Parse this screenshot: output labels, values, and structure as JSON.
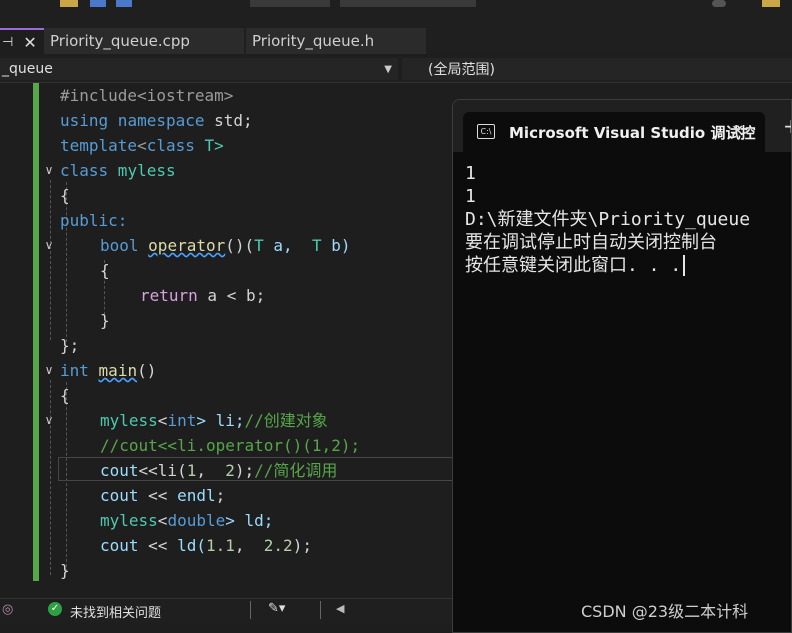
{
  "tabs": [
    {
      "label": "Priority_queue.cpp",
      "active": true
    },
    {
      "label": "Priority_queue.h",
      "active": false
    }
  ],
  "nav": {
    "scope_left": "_queue",
    "scope_right": "(全局范围)"
  },
  "code": {
    "l1": "#include<iostream>",
    "l2_a": "using",
    "l2_b": " namespace",
    "l2_c": " std;",
    "l3_a": "template",
    "l3_b": "<",
    "l3_c": "class",
    "l3_d": " T>",
    "l4_a": "class",
    "l4_b": " myless",
    "l5": "{",
    "l6": "public:",
    "l7_a": "bool",
    "l7_b": "operator",
    "l7_c": "()(",
    "l7_d": "T",
    "l7_e": " a,  ",
    "l7_f": "T",
    "l7_g": " b)",
    "l8": "{",
    "l9_a": "return",
    "l9_b": " a < b;",
    "l10": "}",
    "l11": "};",
    "l12_a": "int",
    "l12_b": "main",
    "l12_c": "()",
    "l13": "{",
    "l14_a": "myless",
    "l14_b": "<",
    "l14_c": "int",
    "l14_d": "> li;",
    "l14_e": "//创建对象",
    "l15": "//cout<<li.operator()(1,2);",
    "l16_a": "cout",
    "l16_b": "<<li(",
    "l16_c": "1",
    "l16_d": ",  ",
    "l16_e": "2",
    "l16_f": ");",
    "l16_g": "//简化调用",
    "l17_a": "cout",
    "l17_b": " << ",
    "l17_c": "endl",
    "l17_d": ";",
    "l18_a": "myless",
    "l18_b": "<",
    "l18_c": "double",
    "l18_d": "> ld;",
    "l19_a": "cout",
    "l19_b": " << ",
    "l19_c": "ld(",
    "l19_d": "1.1",
    "l19_e": ",  ",
    "l19_f": "2.2",
    "l19_g": ");",
    "l20": "}"
  },
  "status": {
    "issues": "未找到相关问题"
  },
  "console": {
    "title": "Microsoft Visual Studio 调试控",
    "close": "✕",
    "new_tab": "+",
    "lines": [
      "1",
      "1",
      "D:\\新建文件夹\\Priority_queue",
      "要在调试停止时自动关闭控制台",
      "按任意键关闭此窗口. . ."
    ]
  },
  "watermark": "CSDN @23级二本计科",
  "colors": {
    "accent": "#9b6bd7",
    "change_bar": "#57a64a"
  }
}
